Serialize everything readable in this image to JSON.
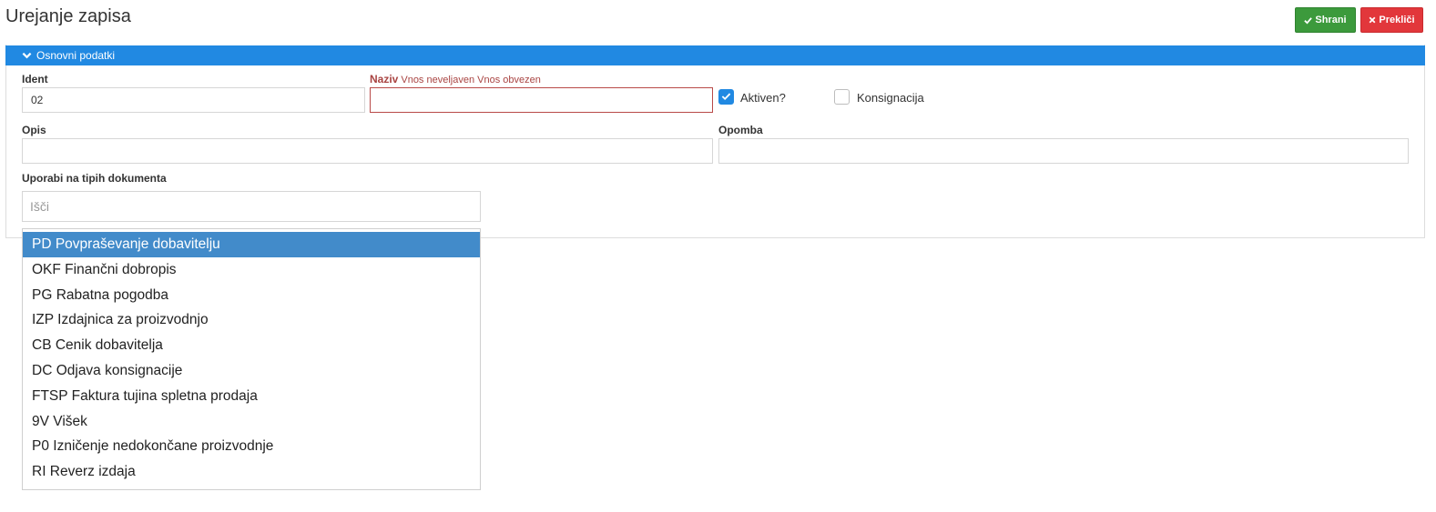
{
  "header": {
    "title": "Urejanje zapisa",
    "save_label": "Shrani",
    "cancel_label": "Prekliči"
  },
  "panel": {
    "title": "Osnovni podatki"
  },
  "form": {
    "ident": {
      "label": "Ident",
      "value": "02"
    },
    "naziv": {
      "label": "Naziv",
      "errors": "Vnos neveljaven Vnos obvezen",
      "value": ""
    },
    "aktiven": {
      "label": "Aktiven?",
      "checked": true
    },
    "konsignacija": {
      "label": "Konsignacija",
      "checked": false
    },
    "opis": {
      "label": "Opis",
      "value": ""
    },
    "opomba": {
      "label": "Opomba",
      "value": ""
    },
    "uporabi": {
      "label": "Uporabi na tipih dokumenta",
      "search_placeholder": "Išči",
      "options": [
        "PD Povpraševanje dobavitelju",
        "OKF Finančni dobropis",
        "PG Rabatna pogodba",
        "IZP Izdajnica za proizvodnjo",
        "CB Cenik dobavitelja",
        "DC Odjava konsignacije",
        "FTSP Faktura tujina spletna prodaja",
        "9V Višek",
        "P0 Izničenje nedokončane proizvodnje",
        "RI Reverz izdaja"
      ],
      "selected_index": 0
    }
  },
  "colors": {
    "header_blue": "#2189e2",
    "save_green": "#3c9a3c",
    "cancel_red": "#e2373b",
    "error_red": "#a94442",
    "selected_option": "#428bca"
  },
  "icons": {
    "save": "check-icon",
    "cancel": "times-icon",
    "panel": "chevron-down-icon",
    "checkbox": "check-icon"
  }
}
